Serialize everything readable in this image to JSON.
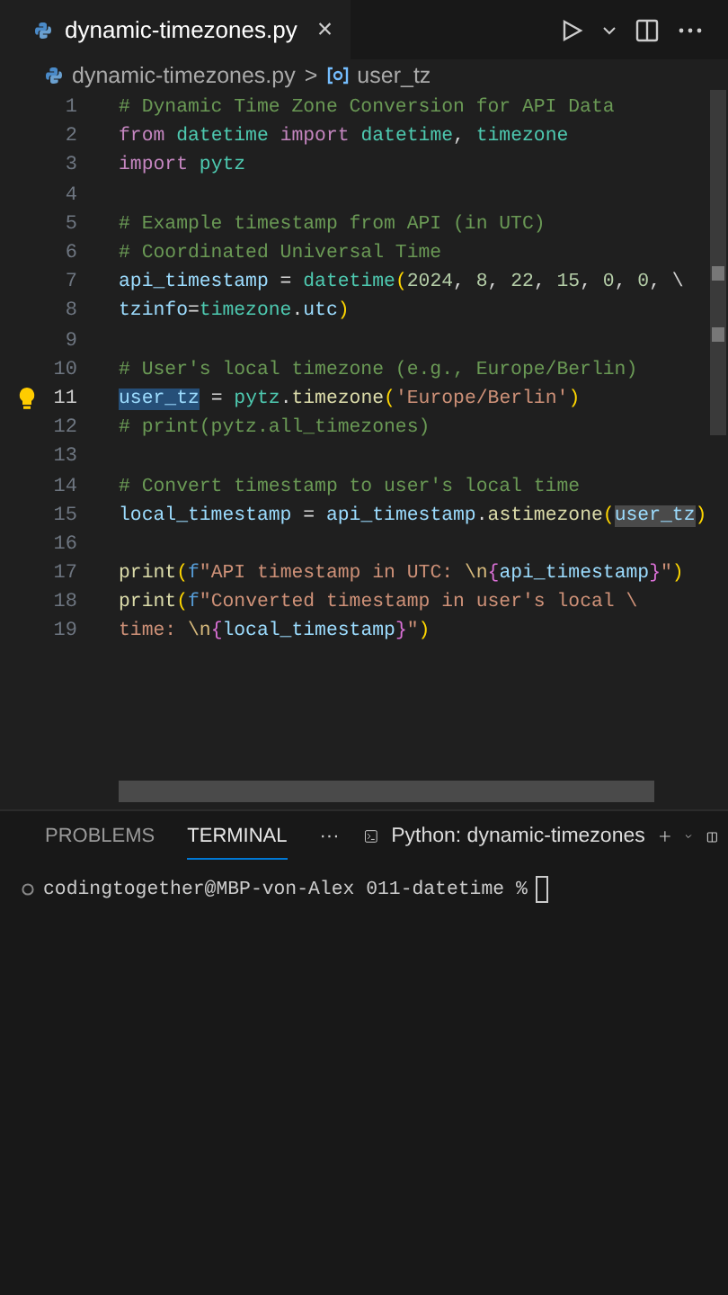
{
  "editor_tab": {
    "filename": "dynamic-timezones.py",
    "close": "×"
  },
  "breadcrumb": {
    "file": "dynamic-timezones.py",
    "separator": ">",
    "symbol": "user_tz"
  },
  "code_lines": [
    {
      "number": "1",
      "active": false,
      "tokens": [
        {
          "kind": "comment",
          "text": "# Dynamic Time Zone Conversion for API Data"
        }
      ]
    },
    {
      "number": "2",
      "active": false,
      "tokens": [
        {
          "kind": "keyword",
          "text": "from "
        },
        {
          "kind": "module",
          "text": "datetime "
        },
        {
          "kind": "keyword",
          "text": "import "
        },
        {
          "kind": "module",
          "text": "datetime"
        },
        {
          "kind": "plain",
          "text": ", "
        },
        {
          "kind": "module",
          "text": "timezone"
        }
      ]
    },
    {
      "number": "3",
      "active": false,
      "tokens": [
        {
          "kind": "keyword",
          "text": "import "
        },
        {
          "kind": "module",
          "text": "pytz"
        }
      ]
    },
    {
      "number": "4",
      "active": false
    },
    {
      "number": "5",
      "active": false,
      "tokens": [
        {
          "kind": "comment",
          "text": "# Example timestamp from API (in UTC)"
        }
      ]
    },
    {
      "number": "6",
      "active": false,
      "tokens": [
        {
          "kind": "comment",
          "text": "# Coordinated Universal Time"
        }
      ]
    },
    {
      "number": "7",
      "active": false,
      "tokens": [
        {
          "kind": "variable",
          "text": "api_timestamp"
        },
        {
          "kind": "plain",
          "text": " = "
        },
        {
          "kind": "module",
          "text": "datetime"
        },
        {
          "kind": "paren",
          "text": "("
        },
        {
          "kind": "number",
          "text": "2024"
        },
        {
          "kind": "plain",
          "text": ", "
        },
        {
          "kind": "number",
          "text": "8"
        },
        {
          "kind": "plain",
          "text": ", "
        },
        {
          "kind": "number",
          "text": "22"
        },
        {
          "kind": "plain",
          "text": ", "
        },
        {
          "kind": "number",
          "text": "15"
        },
        {
          "kind": "plain",
          "text": ", "
        },
        {
          "kind": "number",
          "text": "0"
        },
        {
          "kind": "plain",
          "text": ", "
        },
        {
          "kind": "number",
          "text": "0"
        },
        {
          "kind": "plain",
          "text": ", \\"
        }
      ]
    },
    {
      "number": "8",
      "active": false,
      "tokens": [
        {
          "kind": "variable",
          "text": "tzinfo"
        },
        {
          "kind": "plain",
          "text": "="
        },
        {
          "kind": "module",
          "text": "timezone"
        },
        {
          "kind": "plain",
          "text": "."
        },
        {
          "kind": "variable",
          "text": "utc"
        },
        {
          "kind": "paren",
          "text": ")"
        }
      ]
    },
    {
      "number": "9",
      "active": false
    },
    {
      "number": "10",
      "active": false,
      "tokens": [
        {
          "kind": "comment",
          "text": "# User's local timezone (e.g., Europe/Berlin)"
        }
      ]
    },
    {
      "number": "11",
      "active": true,
      "tokens": [
        {
          "kind": "variable-selected",
          "text": "user_tz"
        },
        {
          "kind": "plain",
          "text": " = "
        },
        {
          "kind": "module",
          "text": "pytz"
        },
        {
          "kind": "plain",
          "text": "."
        },
        {
          "kind": "function",
          "text": "timezone"
        },
        {
          "kind": "paren",
          "text": "("
        },
        {
          "kind": "string",
          "text": "'Europe/Berlin'"
        },
        {
          "kind": "paren",
          "text": ")"
        }
      ]
    },
    {
      "number": "12",
      "active": false,
      "tokens": [
        {
          "kind": "comment",
          "text": "# print(pytz.all_timezones)"
        }
      ]
    },
    {
      "number": "13",
      "active": false
    },
    {
      "number": "14",
      "active": false,
      "tokens": [
        {
          "kind": "comment",
          "text": "# Convert timestamp to user's local time"
        }
      ]
    },
    {
      "number": "15",
      "active": false,
      "tokens": [
        {
          "kind": "variable",
          "text": "local_timestamp"
        },
        {
          "kind": "plain",
          "text": " = "
        },
        {
          "kind": "variable",
          "text": "api_timestamp"
        },
        {
          "kind": "plain",
          "text": "."
        },
        {
          "kind": "function",
          "text": "astimezone"
        },
        {
          "kind": "paren",
          "text": "("
        },
        {
          "kind": "variable-occurrence",
          "text": "user_tz"
        },
        {
          "kind": "paren",
          "text": ")"
        }
      ]
    },
    {
      "number": "16",
      "active": false
    },
    {
      "number": "17",
      "active": false,
      "tokens": [
        {
          "kind": "function",
          "text": "print"
        },
        {
          "kind": "paren",
          "text": "("
        },
        {
          "kind": "keyword-blue",
          "text": "f"
        },
        {
          "kind": "string",
          "text": "\"API timestamp in UTC: "
        },
        {
          "kind": "escape",
          "text": "\\n"
        },
        {
          "kind": "brace",
          "text": "{"
        },
        {
          "kind": "variable",
          "text": "api_timestamp"
        },
        {
          "kind": "brace",
          "text": "}"
        },
        {
          "kind": "string",
          "text": "\""
        },
        {
          "kind": "paren",
          "text": ")"
        }
      ]
    },
    {
      "number": "18",
      "active": false,
      "tokens": [
        {
          "kind": "function",
          "text": "print"
        },
        {
          "kind": "paren",
          "text": "("
        },
        {
          "kind": "keyword-blue",
          "text": "f"
        },
        {
          "kind": "string",
          "text": "\"Converted timestamp in user's local \\"
        }
      ]
    },
    {
      "number": "19",
      "active": false,
      "tokens": [
        {
          "kind": "string",
          "text": "time: "
        },
        {
          "kind": "escape",
          "text": "\\n"
        },
        {
          "kind": "brace",
          "text": "{"
        },
        {
          "kind": "variable",
          "text": "local_timestamp"
        },
        {
          "kind": "brace",
          "text": "}"
        },
        {
          "kind": "string",
          "text": "\""
        },
        {
          "kind": "paren",
          "text": ")"
        }
      ]
    }
  ],
  "panel_tabs": [
    {
      "label": "PROBLEMS",
      "selected": false
    },
    {
      "label": "TERMINAL",
      "selected": true
    }
  ],
  "panel_more": "···",
  "terminal_name": "Python: dynamic-timezones",
  "terminal_prompt": "codingtogether@MBP-von-Alex 011-datetime %"
}
